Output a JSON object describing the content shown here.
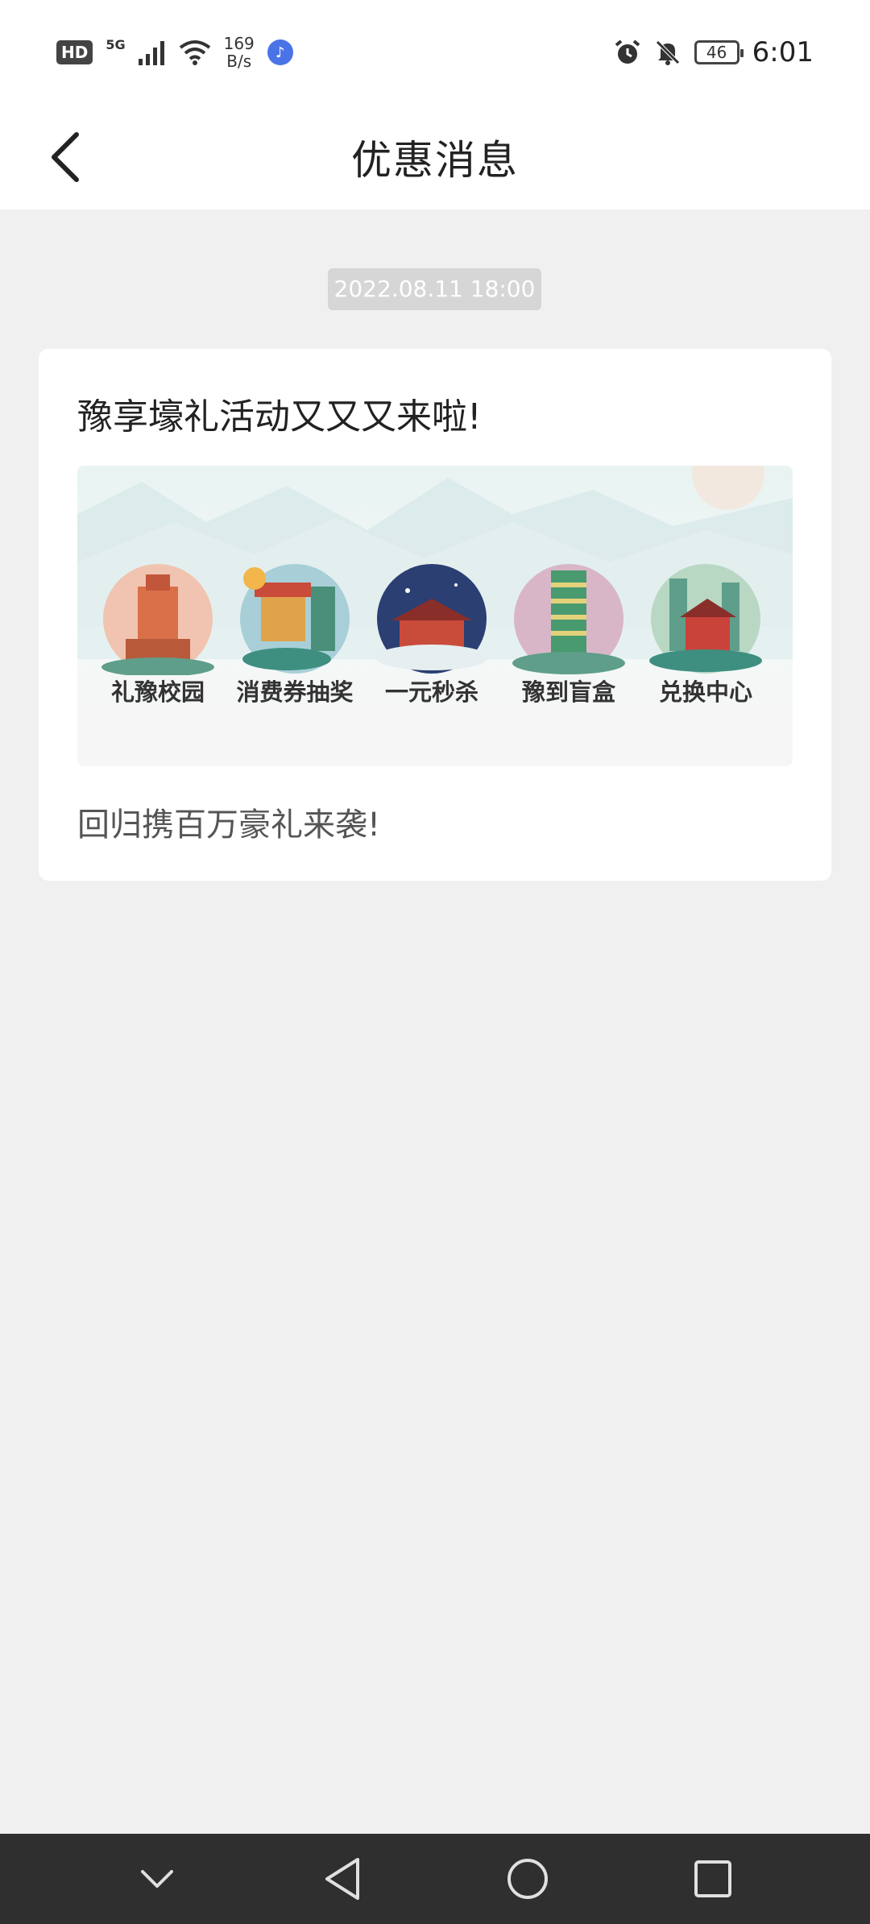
{
  "status_bar": {
    "hd": "HD",
    "network": "5G",
    "speed_value": "169",
    "speed_unit": "B/s",
    "battery": "46",
    "time": "6:01"
  },
  "header": {
    "title": "优惠消息"
  },
  "message": {
    "timestamp": "2022.08.11 18:00",
    "title": "豫享壕礼活动又又又来啦!",
    "banner_items": [
      {
        "label": "礼豫校园",
        "color": "#d9704a"
      },
      {
        "label": "消费券抽奖",
        "color": "#c94b3a"
      },
      {
        "label": "一元秒杀",
        "color": "#2b3f73"
      },
      {
        "label": "豫到盲盒",
        "color": "#3a8f6e"
      },
      {
        "label": "兑换中心",
        "color": "#c9433b"
      }
    ],
    "description": "回归携百万豪礼来袭!"
  },
  "colors": {
    "background": "#f0f0f0",
    "card": "#ffffff",
    "nav_bar": "#2f2f2f",
    "timestamp_bg": "#d6d6d6"
  }
}
